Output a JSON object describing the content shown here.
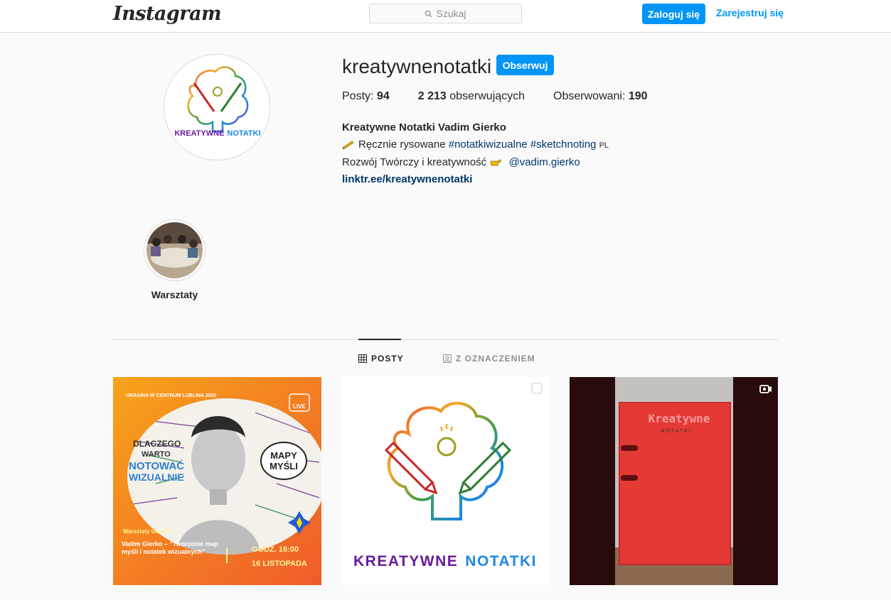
{
  "nav": {
    "logo": "Instagram",
    "search_placeholder": "Szukaj",
    "login_label": "Zaloguj się",
    "register_label": "Zarejestruj się"
  },
  "profile": {
    "username": "kreatywnenotatki",
    "follow_label": "Obserwuj",
    "stats": {
      "posts_label": "Posty:",
      "posts_count": "94",
      "followers_count": "2 213",
      "followers_label": "obserwujących",
      "following_label": "Obserwowani:",
      "following_count": "190"
    },
    "bio": {
      "name": "Kreatywne Notatki Vadim Gierko",
      "line1_text": "Ręcznie rysowane",
      "line1_tag1": "#notatkiwizualne",
      "line1_tag2": "#sketchnoting",
      "line1_suffix": "PL",
      "line2_text": "Rozwój Twórczy i kreatywność",
      "line2_mention": "@vadim.gierko",
      "link": "linktr.ee/kreatywnenotatki"
    },
    "avatar_logo_text": {
      "word1": "KREATYWNE",
      "word2": "NOTATKI"
    }
  },
  "highlights": [
    {
      "label": "Warsztaty"
    }
  ],
  "tabs": {
    "posts": "POSTY",
    "tagged": "Z OZNACZENIEM"
  },
  "posts": {
    "post1": {
      "header": "UKRAINA W CENTRUM LUBLINA 2020",
      "live": "LIVE",
      "headline1": "DLACZEGO",
      "headline2": "WARTO",
      "headline3": "NOTOWAĆ",
      "headline4": "WIZUALNIE",
      "bubble1": "MAPY",
      "bubble2": "MYŚLI",
      "workshop": "Warsztaty UkrART",
      "speaker": "Vadim Gierko – \"Tworzenie map myśli i notatek wizualnych\"",
      "time": "GODZ. 16:00",
      "date": "16 LISTOPADA"
    },
    "post2": {
      "word1": "KREATYWNE",
      "word2": "NOTATKI"
    },
    "post3": {
      "binder_title": "Kreatywne",
      "binder_sub": "NOTATKI"
    }
  },
  "colors": {
    "brand_blue": "#0095f6",
    "link_dark_blue": "#00376b",
    "border": "#dbdbdb",
    "background": "#fafafa"
  }
}
